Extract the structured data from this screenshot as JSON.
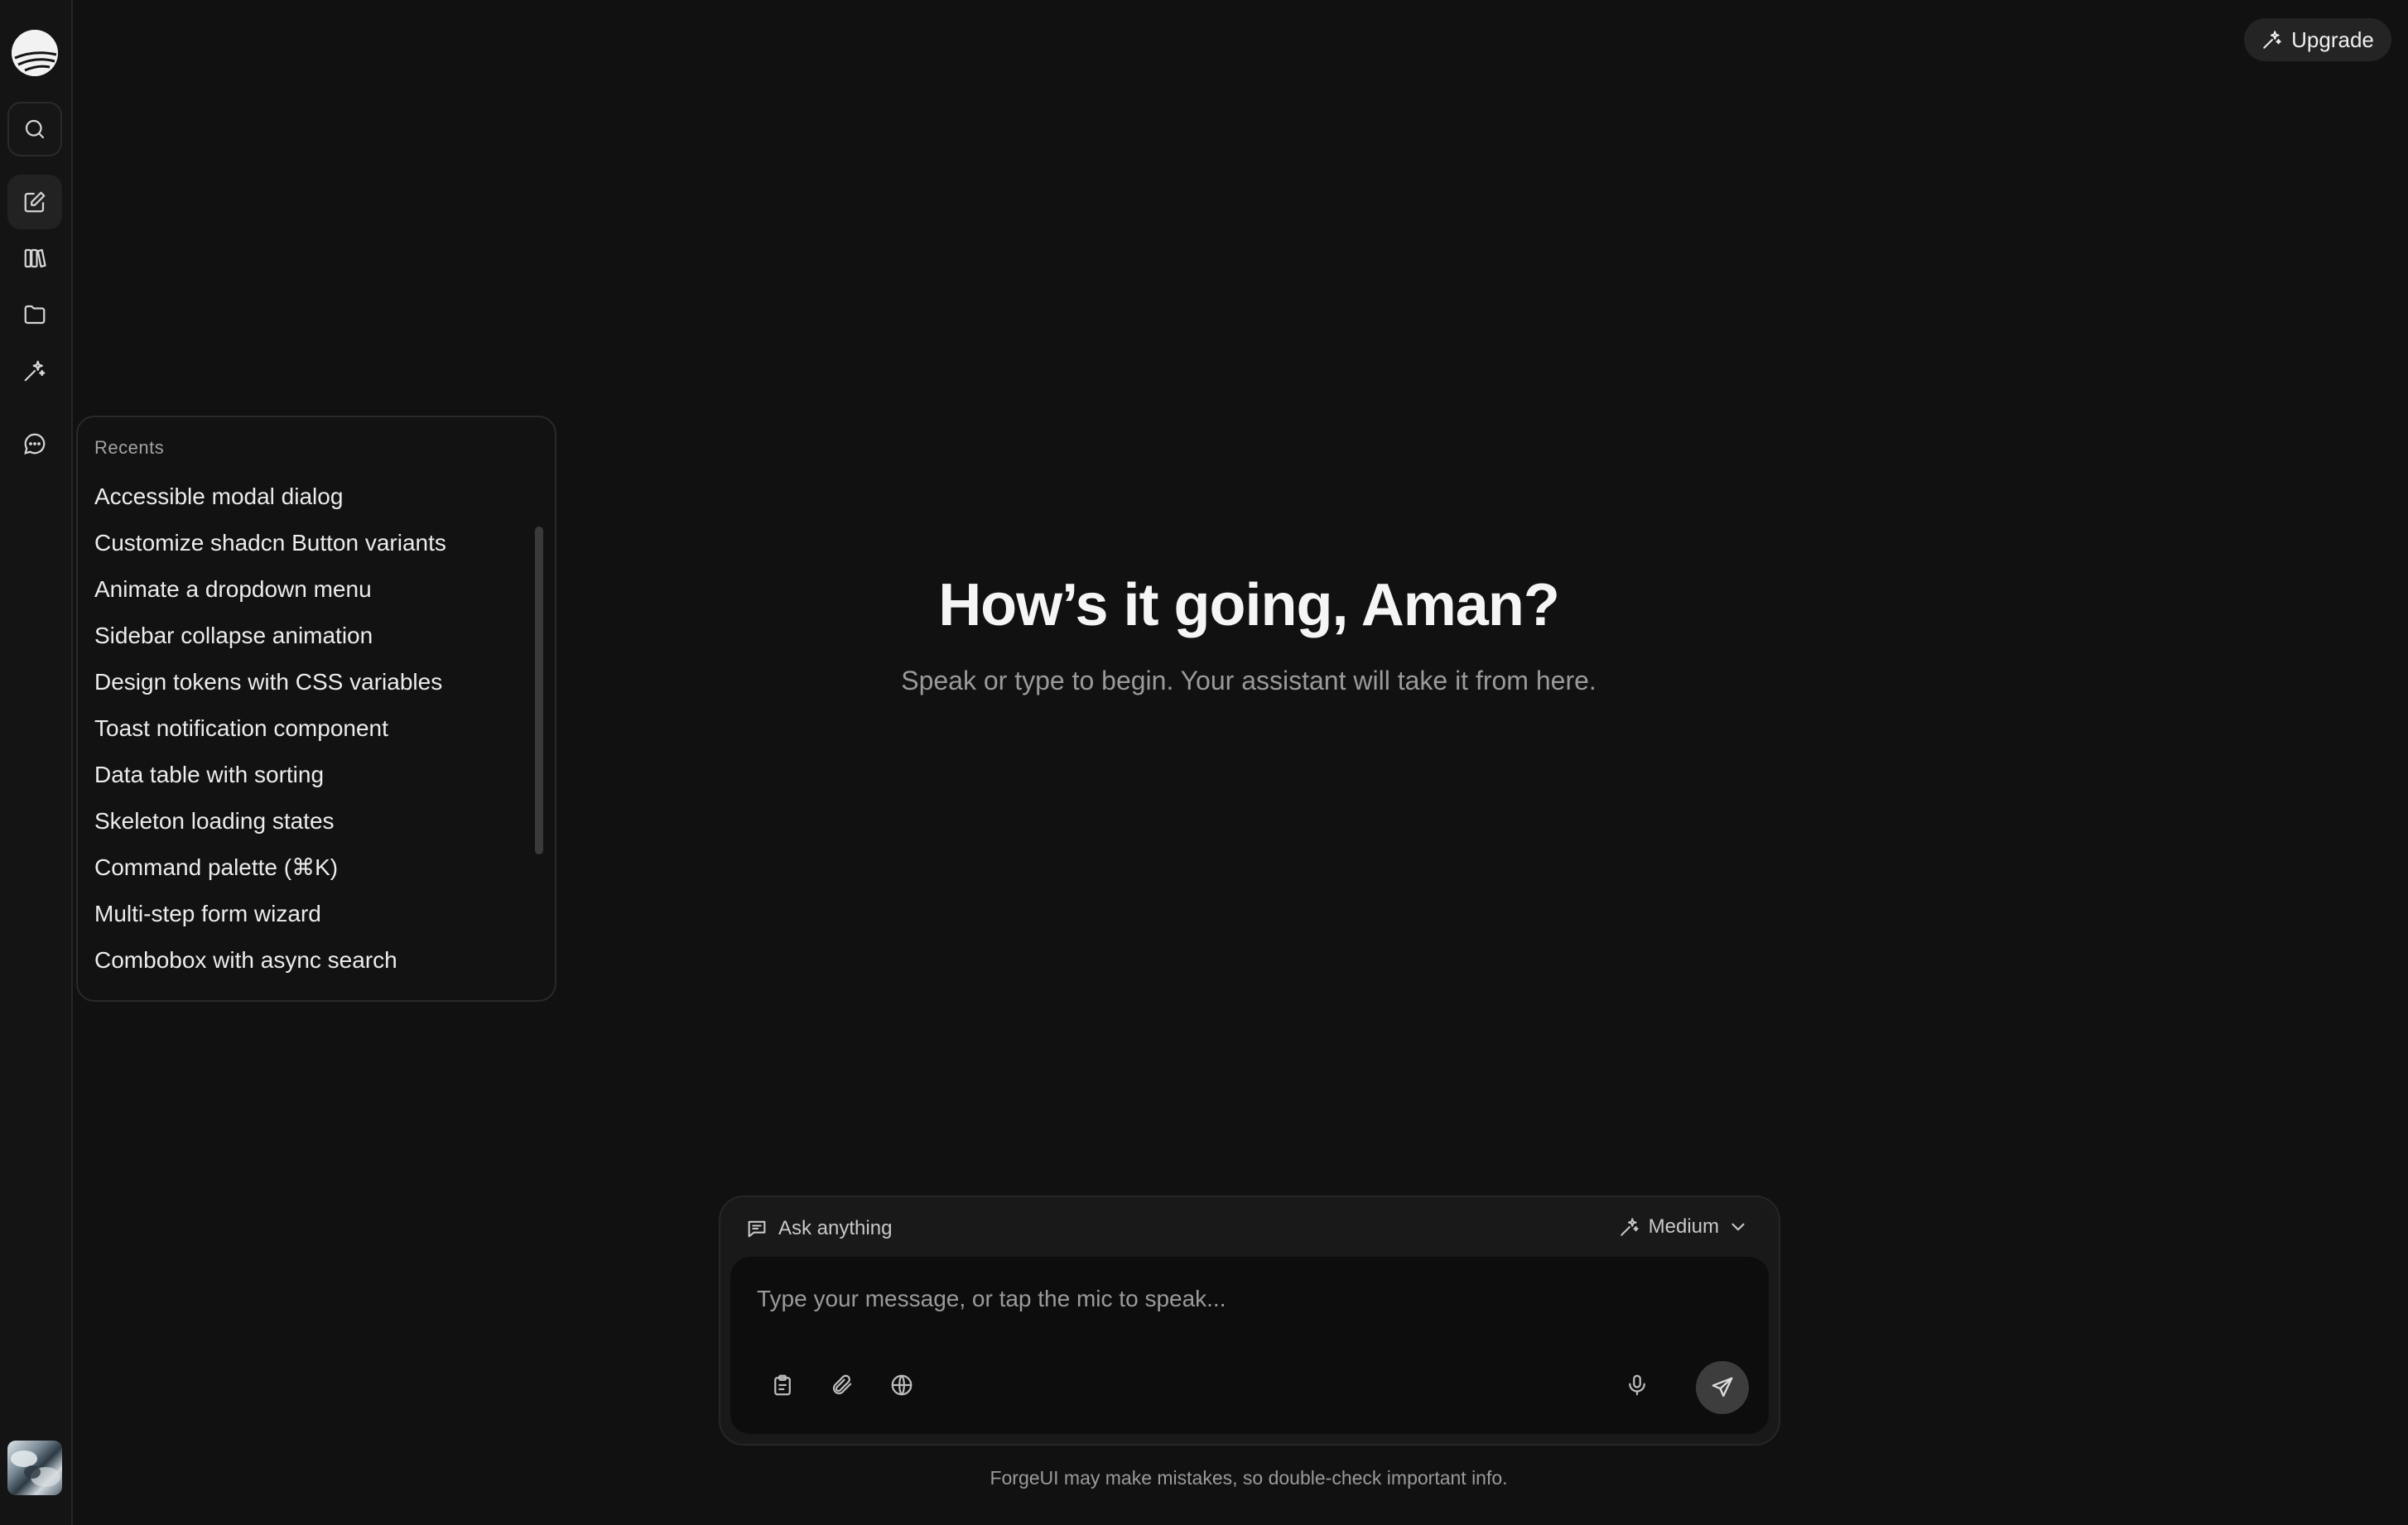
{
  "header": {
    "upgrade_label": "Upgrade"
  },
  "sidebar": {
    "items": [
      {
        "name": "search",
        "icon": "search-icon"
      },
      {
        "name": "new-chat",
        "icon": "edit-icon"
      },
      {
        "name": "library",
        "icon": "books-icon"
      },
      {
        "name": "projects",
        "icon": "folder-icon"
      },
      {
        "name": "magic",
        "icon": "sparkles-icon"
      },
      {
        "name": "chats",
        "icon": "chat-bubble-icon"
      }
    ]
  },
  "recents": {
    "title": "Recents",
    "items": [
      "Accessible modal dialog",
      "Customize shadcn Button variants",
      "Animate a dropdown menu",
      "Sidebar collapse animation",
      "Design tokens with CSS variables",
      "Toast notification component",
      "Data table with sorting",
      "Skeleton loading states",
      "Command palette (⌘K)",
      "Multi-step form wizard",
      "Combobox with async search"
    ]
  },
  "hero": {
    "title": "How’s it going, Aman?",
    "subtitle": "Speak or type to begin. Your assistant will take it from here."
  },
  "composer": {
    "mode_label": "Ask anything",
    "model_label": "Medium",
    "input_value": "",
    "placeholder": "Type your message, or tap the mic to speak..."
  },
  "footer": {
    "disclaimer": "ForgeUI may make mistakes, so double-check important info."
  },
  "colors": {
    "background": "#111111",
    "rail": "#141414",
    "accent": "#f5f5f5",
    "send_button": "#3d3d3d"
  }
}
